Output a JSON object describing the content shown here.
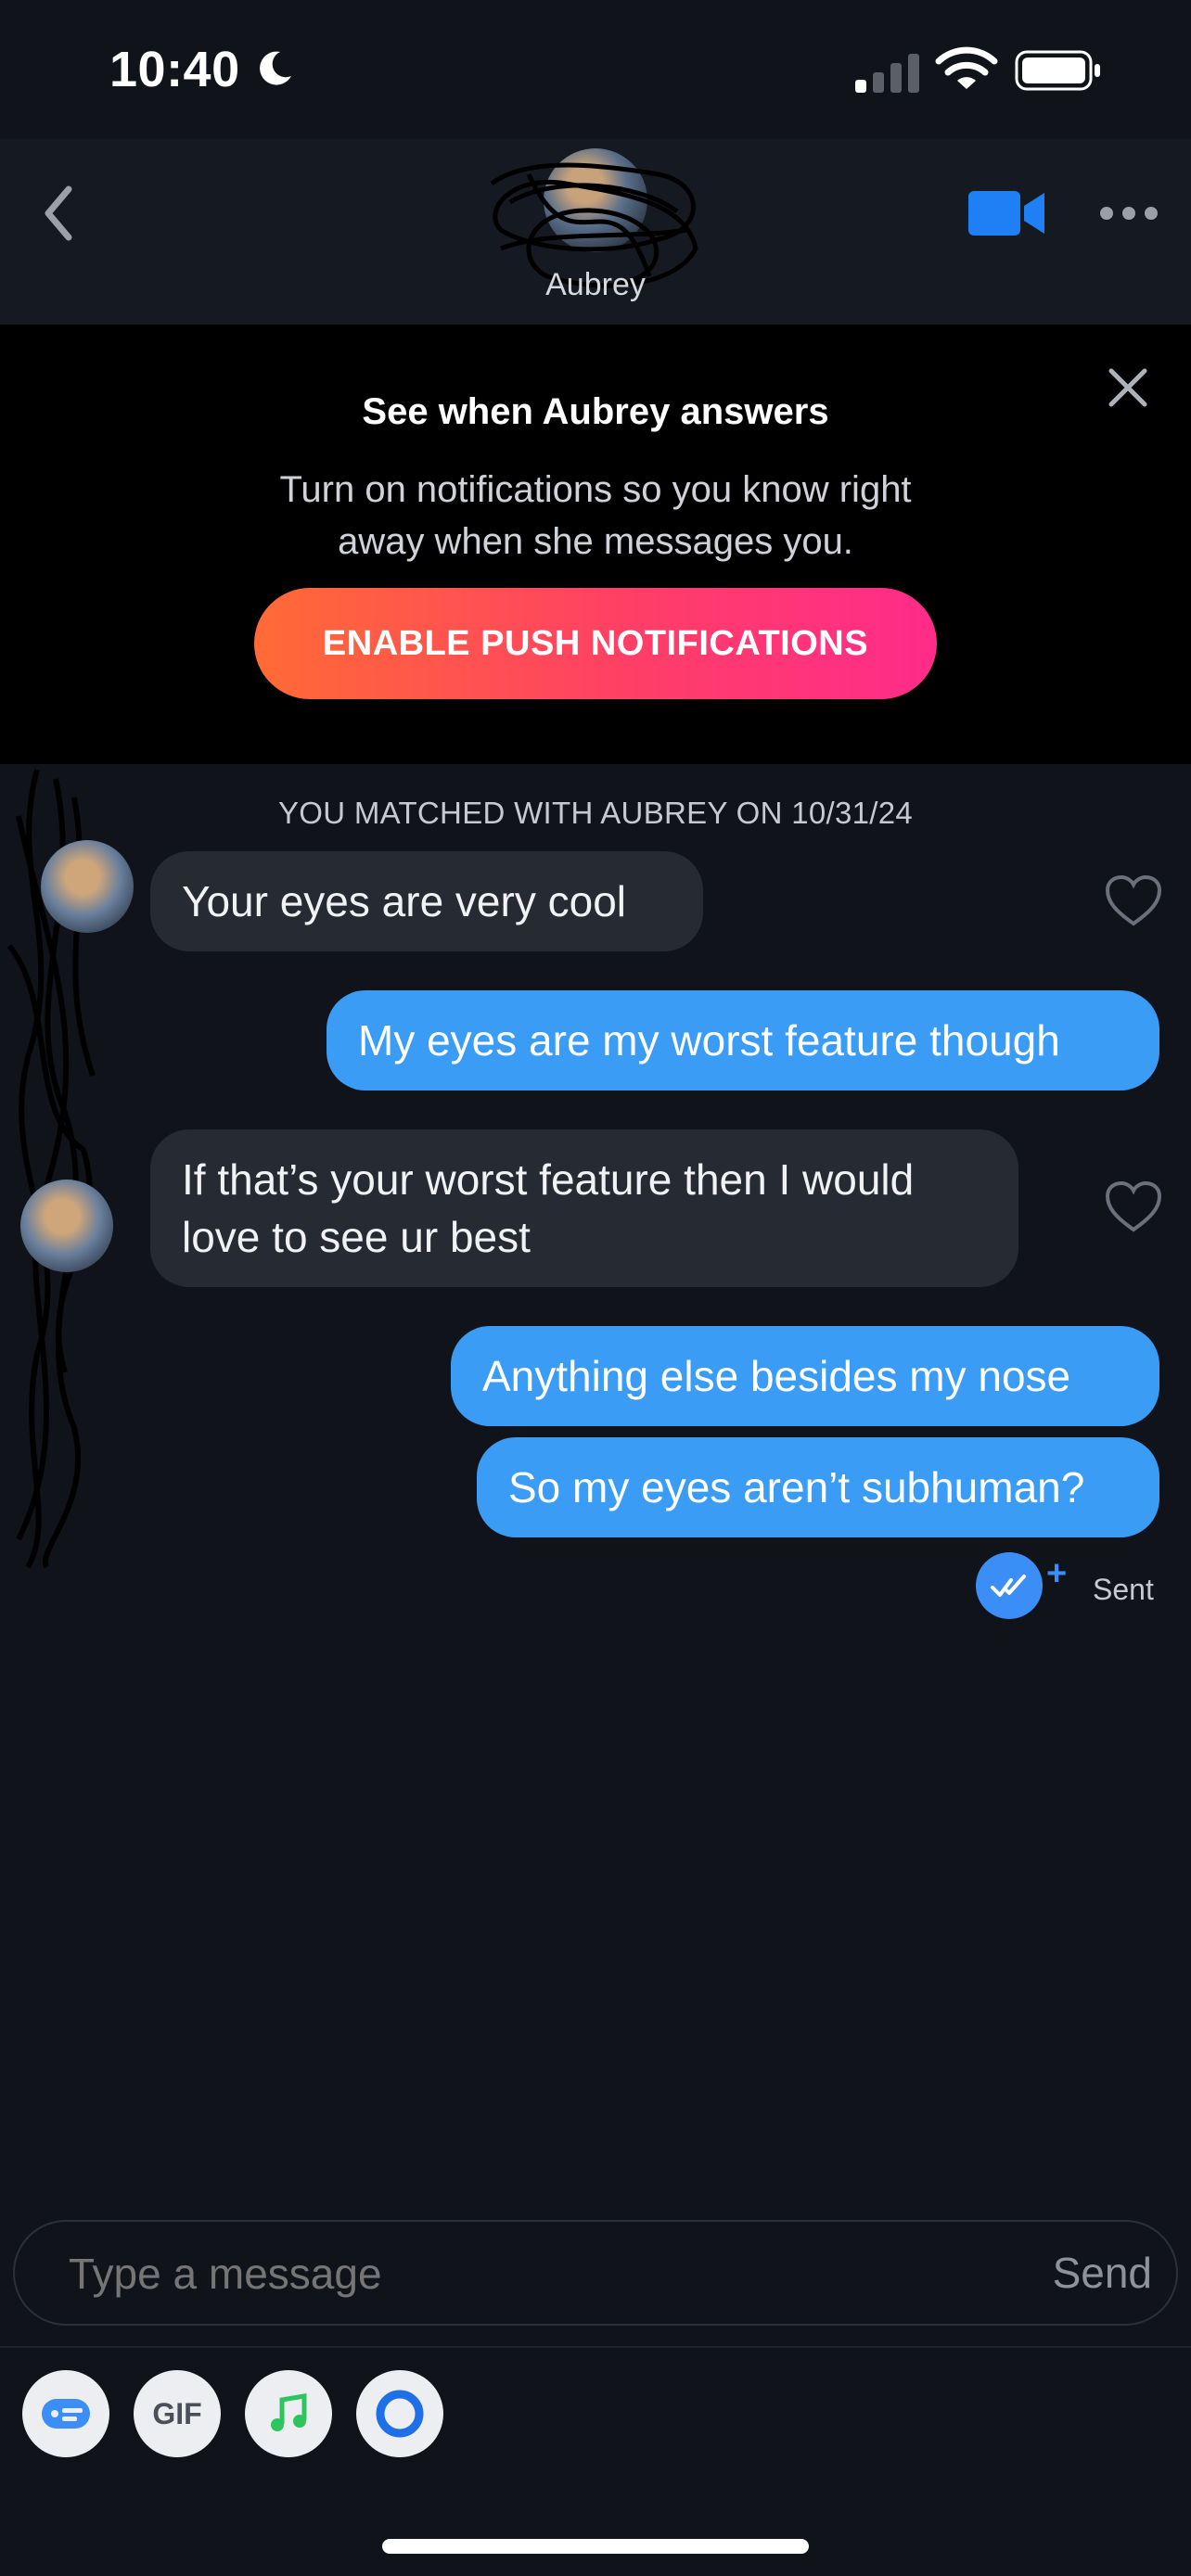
{
  "status_bar": {
    "time": "10:40",
    "icons": [
      "moon-icon",
      "signal-icon",
      "wifi-icon",
      "battery-icon"
    ]
  },
  "header": {
    "name": "Aubrey",
    "icons": [
      "back-chevron-icon",
      "video-call-icon",
      "more-options-icon"
    ]
  },
  "banner": {
    "title": "See when Aubrey answers",
    "body": "Turn on notifications so you know right away when she messages you.",
    "button_label": "ENABLE PUSH NOTIFICATIONS"
  },
  "chat": {
    "match_line": "YOU MATCHED WITH AUBREY ON 10/31/24",
    "messages": [
      {
        "from": "them",
        "text": "Your eyes are very cool"
      },
      {
        "from": "me",
        "text": "My eyes are my worst feature though"
      },
      {
        "from": "them",
        "text": "If that’s your worst feature then I would love to see ur best"
      },
      {
        "from": "me",
        "text": "Anything else besides my nose"
      },
      {
        "from": "me",
        "text": "So my eyes aren’t subhuman?"
      }
    ],
    "receipt": {
      "plus": "+",
      "status": "Sent"
    }
  },
  "composer": {
    "placeholder": "Type a message",
    "send_label": "Send"
  },
  "toolbar": {
    "gif_label": "GIF",
    "icons": [
      "sticker-icon",
      "gif-icon",
      "music-icon",
      "ring-icon"
    ]
  },
  "colors": {
    "outgoing_bubble": "#3a9cf5",
    "incoming_bubble": "#262a33",
    "accent": "#1f7ff5",
    "cta_gradient": [
      "#ff6b35",
      "#ff2b8a"
    ]
  }
}
